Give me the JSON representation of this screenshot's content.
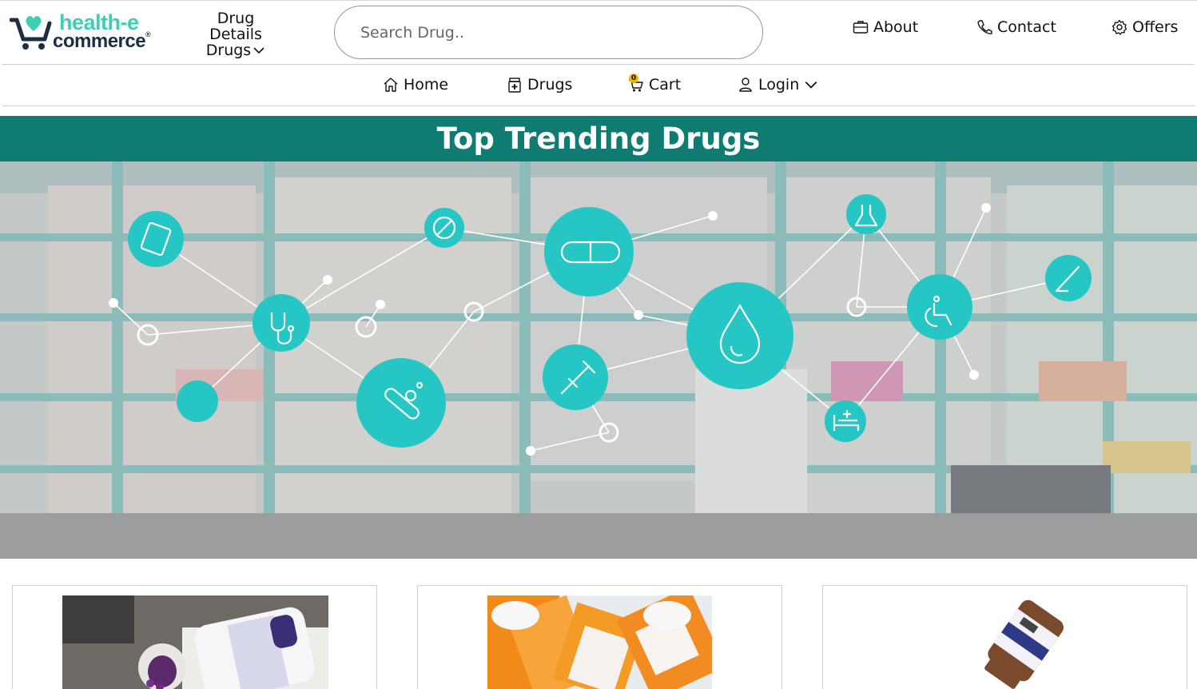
{
  "header": {
    "logo": {
      "line1": "health-e",
      "line2": "commerce",
      "trademark": "®"
    },
    "drug_menu": {
      "title": "Drug Details",
      "sub_label": "Drugs"
    },
    "search": {
      "placeholder": "Search Drug..",
      "value": ""
    },
    "links": [
      {
        "label": "About",
        "icon": "briefcase-icon"
      },
      {
        "label": "Contact",
        "icon": "phone-icon"
      },
      {
        "label": "Offers",
        "icon": "gear-icon"
      }
    ]
  },
  "nav": {
    "items": [
      {
        "label": "Home",
        "icon": "home-icon"
      },
      {
        "label": "Drugs",
        "icon": "medicine-icon"
      },
      {
        "label": "Cart",
        "icon": "cart-icon",
        "badge": "0"
      },
      {
        "label": "Login",
        "icon": "user-icon"
      }
    ]
  },
  "banner": {
    "title": "Top Trending Drugs"
  },
  "colors": {
    "accent": "#107b70",
    "brand_teal": "#3ccfb2",
    "brand_navy": "#1d2e44",
    "node_teal": "#26c6c5"
  },
  "cards": [
    {
      "image": "nexium-bottle-image"
    },
    {
      "image": "pill-bottles-image"
    },
    {
      "image": "generic-drug-bottle-image"
    }
  ]
}
